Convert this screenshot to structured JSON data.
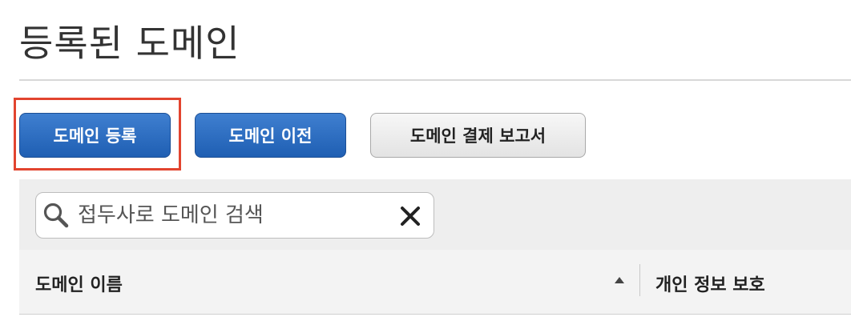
{
  "header": {
    "title": "등록된 도메인"
  },
  "toolbar": {
    "register_label": "도메인 등록",
    "transfer_label": "도메인 이전",
    "billing_report_label": "도메인 결제 보고서"
  },
  "search": {
    "value": "",
    "placeholder": "접두사로 도메인 검색",
    "icon": "search-icon",
    "clear_icon": "close-icon"
  },
  "table": {
    "columns": [
      {
        "label": "도메인 이름",
        "sort": "ascending"
      },
      {
        "label": "개인 정보 보호"
      }
    ]
  },
  "colors": {
    "primary_button": "#2a6bc0",
    "highlight_border": "#e2442f",
    "panel_background": "#eeeeee"
  }
}
